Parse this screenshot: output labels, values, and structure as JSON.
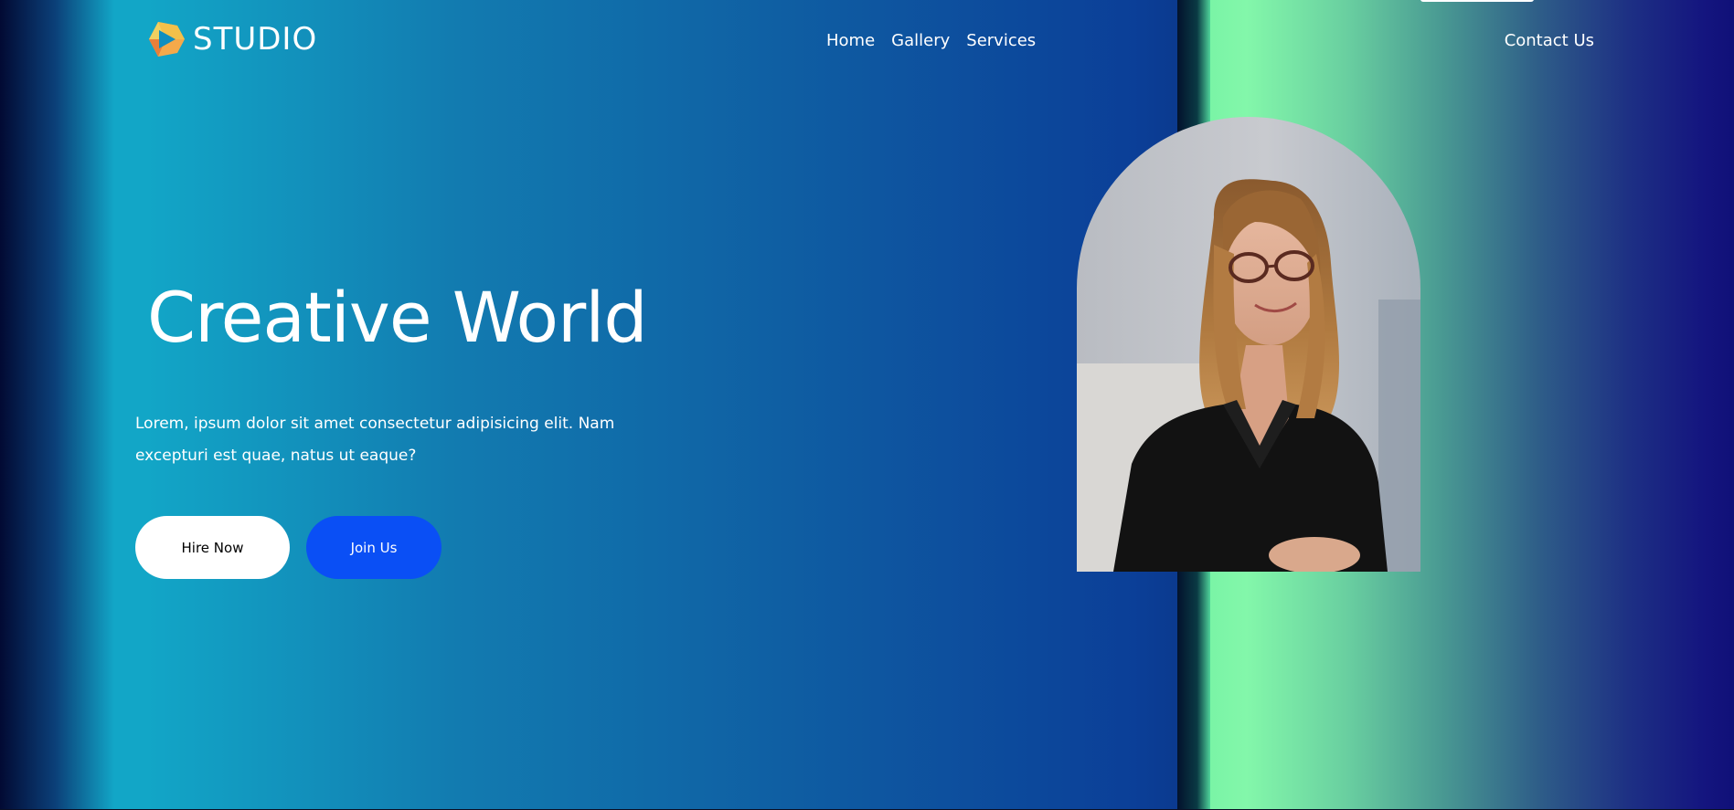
{
  "header": {
    "logo_text": "STUDIO",
    "logo_icon": "play-hexagon-logo-icon",
    "nav": [
      {
        "label": "Home"
      },
      {
        "label": "Gallery"
      },
      {
        "label": "Services"
      }
    ],
    "contact_label": "Contact Us"
  },
  "hero": {
    "title": "Creative World",
    "description": "Lorem, ipsum dolor sit amet consectetur adipisicing elit. Nam excepturi est quae, natus ut eaque?",
    "buttons": {
      "hire_label": "Hire Now",
      "join_label": "Join Us"
    },
    "portrait_alt": "portrait-photo"
  },
  "colors": {
    "join_button": "#0a4ff5",
    "hire_button": "#ffffff",
    "left_bg": "#127bb0",
    "right_bg_start": "#7af4a6",
    "right_bg_end": "#101078"
  }
}
